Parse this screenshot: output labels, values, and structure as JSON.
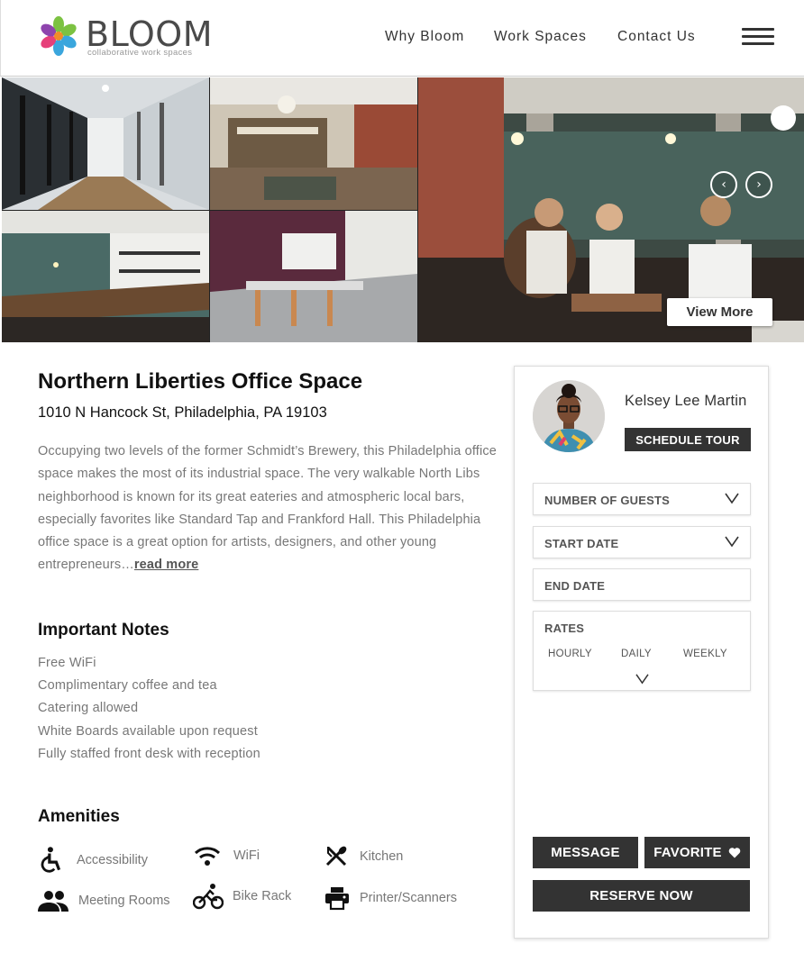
{
  "brand": {
    "name": "BLOOM",
    "tagline": "collaborative work spaces"
  },
  "nav": {
    "items": [
      {
        "label": "Why Bloom"
      },
      {
        "label": "Work Spaces"
      },
      {
        "label": "Contact Us"
      }
    ]
  },
  "gallery": {
    "prev_glyph": "‹",
    "next_glyph": "›",
    "view_more_label": "View More"
  },
  "listing": {
    "title": "Northern Liberties Office Space",
    "address": "1010 N Hancock St, Philadelphia, PA 19103",
    "description": "Occupying two levels of the former Schmidt’s Brewery, this Philadelphia office space makes the most of its industrial space. The very walkable North Libs neighborhood is known for its great eateries and atmospheric local bars, especially favorites like Standard Tap and Frankford Hall. This Philadelphia office space is a great option for artists, designers, and other young entrepreneurs…",
    "read_more_label": "read more"
  },
  "notes": {
    "heading": "Important Notes",
    "items": [
      "Free WiFi",
      "Complimentary coffee and tea",
      "Catering allowed",
      "White Boards available upon request",
      "Fully staffed front desk with reception"
    ]
  },
  "amenities": {
    "heading": "Amenities",
    "items": [
      {
        "label": "Accessibility",
        "icon": "accessibility-icon"
      },
      {
        "label": "WiFi",
        "icon": "wifi-icon"
      },
      {
        "label": "Kitchen",
        "icon": "kitchen-icon"
      },
      {
        "label": "Meeting Rooms",
        "icon": "meeting-rooms-icon"
      },
      {
        "label": "Bike Rack",
        "icon": "bike-icon"
      },
      {
        "label": "Printer/Scanners",
        "icon": "printer-icon"
      }
    ]
  },
  "booking": {
    "host_name": "Kelsey Lee Martin",
    "schedule_label": "SCHEDULE TOUR",
    "guests_label": "NUMBER OF GUESTS",
    "start_label": "START DATE",
    "end_label": "END DATE",
    "rates_label": "RATES",
    "rate_options": [
      "HOURLY",
      "DAILY",
      "WEEKLY"
    ],
    "message_label": "MESSAGE",
    "favorite_label": "FAVORITE",
    "reserve_label": "RESERVE NOW"
  },
  "colors": {
    "dark_button": "#333333",
    "muted_text": "#777777",
    "logo_petals": [
      "#e6407a",
      "#8e44ad",
      "#3aa6dd",
      "#f28c28",
      "#7cc242"
    ]
  }
}
